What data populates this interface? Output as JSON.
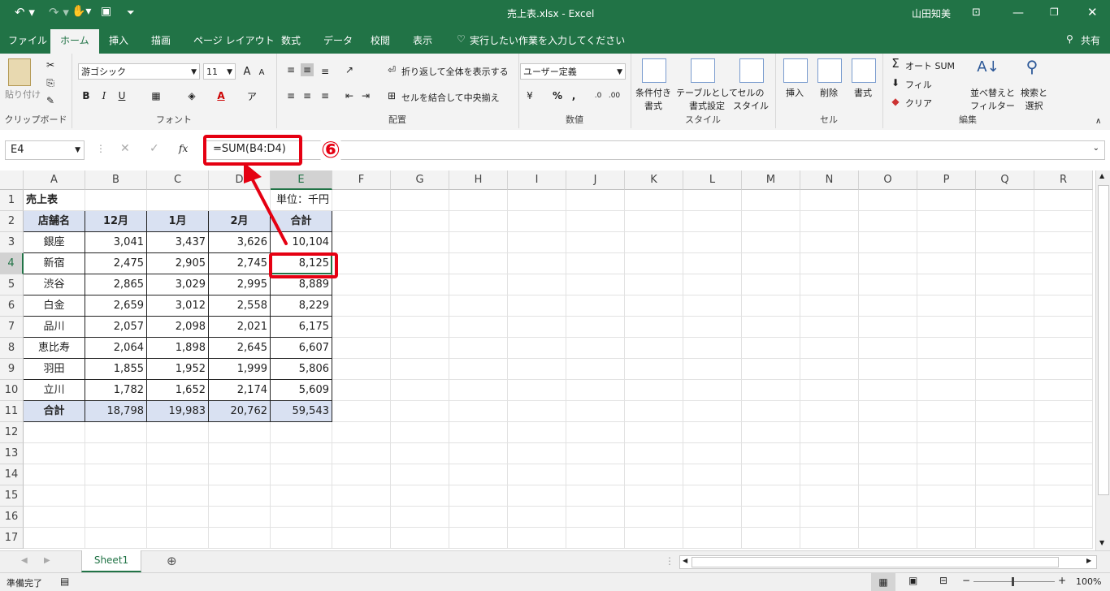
{
  "window": {
    "title": "売上表.xlsx  -  Excel",
    "user": "山田知美"
  },
  "tabs": [
    "ファイル",
    "ホーム",
    "挿入",
    "描画",
    "ページ レイアウト",
    "数式",
    "データ",
    "校閲",
    "表示"
  ],
  "tell_me": "実行したい作業を入力してください",
  "share": "共有",
  "ribbon": {
    "clipboard": {
      "paste": "貼り付け",
      "label": "クリップボード"
    },
    "font": {
      "name": "游ゴシック",
      "size": "11",
      "label": "フォント",
      "bold": "B",
      "italic": "I",
      "underline": "U"
    },
    "alignment": {
      "wrap": "折り返して全体を表示する",
      "merge": "セルを結合して中央揃え",
      "label": "配置"
    },
    "number": {
      "format": "ユーザー定義",
      "percent": "%",
      "comma": ",",
      "label": "数値"
    },
    "styles": {
      "conditional": "条件付き\n書式",
      "table": "テーブルとして\n書式設定",
      "cell": "セルの\nスタイル",
      "cond1": "条件付き",
      "cond2": "書式",
      "table1": "テーブルとして",
      "table2": "書式設定",
      "cell1": "セルの",
      "cell2": "スタイル",
      "label": "スタイル"
    },
    "cells": {
      "insert": "挿入",
      "delete": "削除",
      "format": "書式",
      "label": "セル"
    },
    "editing": {
      "autosum": "オート SUM",
      "fill": "フィル",
      "clear": "クリア",
      "sort1": "並べ替えと",
      "sort2": "フィルター",
      "find1": "検索と",
      "find2": "選択",
      "label": "編集"
    }
  },
  "formula_bar": {
    "name_box": "E4",
    "fx": "fx",
    "formula": "=SUM(B4:D4)"
  },
  "annotation": {
    "step": "⑥"
  },
  "columns": [
    "A",
    "B",
    "C",
    "D",
    "E",
    "F",
    "G",
    "H",
    "I",
    "J",
    "K",
    "L",
    "M",
    "N",
    "O",
    "P",
    "Q",
    "R"
  ],
  "rows": [
    "1",
    "2",
    "3",
    "4",
    "5",
    "6",
    "7",
    "8",
    "9",
    "10",
    "11",
    "12",
    "13",
    "14",
    "15",
    "16",
    "17"
  ],
  "sheet": {
    "title": "売上表",
    "unit": "単位：千円",
    "headers": [
      "店舗名",
      "12月",
      "1月",
      "2月",
      "合計"
    ],
    "data": [
      [
        "銀座",
        "3,041",
        "3,437",
        "3,626",
        "10,104"
      ],
      [
        "新宿",
        "2,475",
        "2,905",
        "2,745",
        "8,125"
      ],
      [
        "渋谷",
        "2,865",
        "3,029",
        "2,995",
        "8,889"
      ],
      [
        "白金",
        "2,659",
        "3,012",
        "2,558",
        "8,229"
      ],
      [
        "品川",
        "2,057",
        "2,098",
        "2,021",
        "6,175"
      ],
      [
        "恵比寿",
        "2,064",
        "1,898",
        "2,645",
        "6,607"
      ],
      [
        "羽田",
        "1,855",
        "1,952",
        "1,999",
        "5,806"
      ],
      [
        "立川",
        "1,782",
        "1,652",
        "2,174",
        "5,609"
      ]
    ],
    "total": [
      "合計",
      "18,798",
      "19,983",
      "20,762",
      "59,543"
    ]
  },
  "sheet_tab": "Sheet1",
  "status": {
    "ready": "準備完了",
    "zoom": "100%"
  },
  "colors": {
    "excel_green": "#217346",
    "highlight_red": "#e50012",
    "header_fill": "#d9e1f2"
  }
}
